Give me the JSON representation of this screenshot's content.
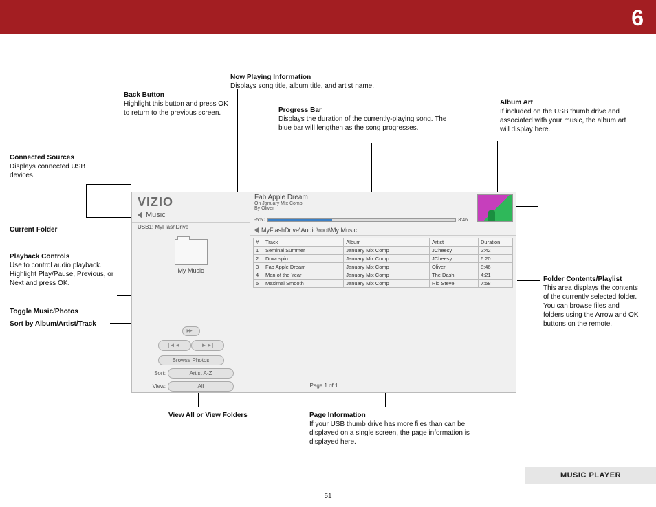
{
  "chapter": "6",
  "page_number": "51",
  "section_label": "MUSIC PLAYER",
  "callouts": {
    "back_button": {
      "title": "Back Button",
      "body": "Highlight this button and press OK to return to the previous screen."
    },
    "now_playing": {
      "title": "Now Playing Information",
      "body": "Displays song title, album title, and artist name."
    },
    "progress_bar": {
      "title": "Progress Bar",
      "body": "Displays the duration of the currently-playing song. The blue bar will lengthen as the song progresses."
    },
    "album_art": {
      "title": "Album Art",
      "body": "If included on the USB thumb drive and associated with your music, the album art will display here."
    },
    "connected_sources": {
      "title": "Connected Sources",
      "body": "Displays connected USB devices."
    },
    "current_folder": {
      "title": "Current Folder",
      "body": ""
    },
    "playback_controls": {
      "title": "Playback Controls",
      "body": "Use to control audio playback. Highlight Play/Pause, Previous, or Next and press OK."
    },
    "toggle": {
      "title": "Toggle Music/Photos",
      "body": ""
    },
    "sort_by": {
      "title": "Sort by Album/Artist/Track",
      "body": ""
    },
    "folder_contents": {
      "title": "Folder Contents/Playlist",
      "body": "This area displays the contents of the currently selected folder. You can browse files and folders using the Arrow and OK buttons on the remote."
    },
    "view_all": {
      "title": "View All or View Folders",
      "body": ""
    },
    "page_info": {
      "title": "Page Information",
      "body": "If your USB thumb drive has more files than can be displayed on a single screen, the page information is displayed here."
    }
  },
  "player": {
    "logo": "VIZIO",
    "music_label": "Music",
    "usb_line": "USB1: MyFlashDrive",
    "folder_caption": "My Music",
    "browse_photos": "Browse Photos",
    "sort_label": "Sort:",
    "sort_value": "Artist A-Z",
    "view_label": "View:",
    "view_value": "All",
    "now_playing": {
      "title": "Fab Apple Dream",
      "on_prefix": "On",
      "album": "January Mix Comp",
      "by_prefix": "By",
      "artist": "Oliver",
      "elapsed": "-5:50",
      "total": "8:46"
    },
    "breadcrumb": "MyFlashDrive\\Audio\\root\\My Music",
    "columns": {
      "num": "#",
      "track": "Track",
      "album": "Album",
      "artist": "Artist",
      "duration": "Duration"
    },
    "tracks": [
      {
        "n": "1",
        "track": "Seminal Summer",
        "album": "January Mix Comp",
        "artist": "JCheesy",
        "duration": "2:42"
      },
      {
        "n": "2",
        "track": "Downspin",
        "album": "January Mix Comp",
        "artist": "JCheesy",
        "duration": "6:20"
      },
      {
        "n": "3",
        "track": "Fab Apple Dream",
        "album": "January Mix Comp",
        "artist": "Oliver",
        "duration": "8:46"
      },
      {
        "n": "4",
        "track": "Man of the Year",
        "album": "January Mix Comp",
        "artist": "The Dash",
        "duration": "4:21"
      },
      {
        "n": "5",
        "track": "Maximal Smooth",
        "album": "January Mix Comp",
        "artist": "Rio Steve",
        "duration": "7:58"
      }
    ],
    "page_info": "Page 1 of 1"
  }
}
